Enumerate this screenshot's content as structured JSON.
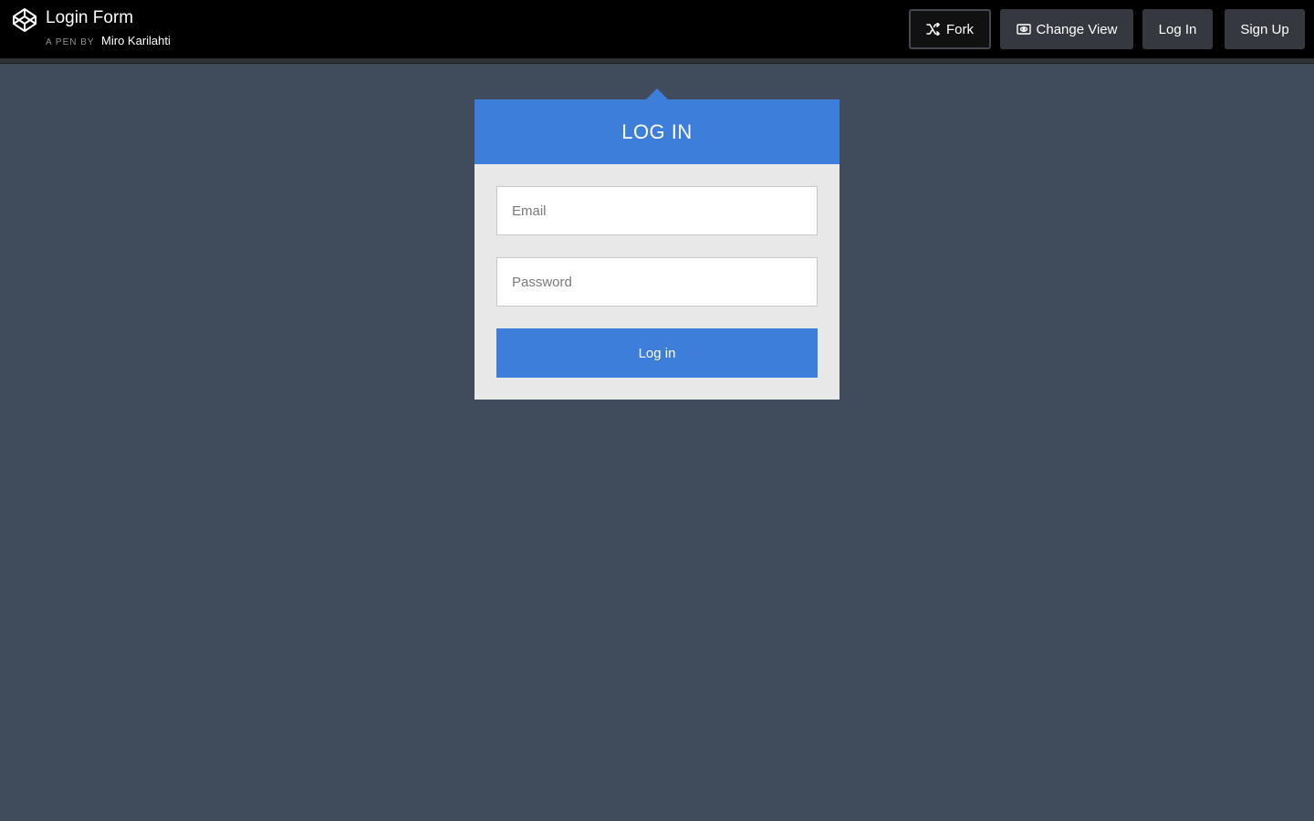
{
  "header": {
    "pen_title": "Login Form",
    "pen_by_label": "A PEN BY",
    "author": "Miro Karilahti",
    "logo_icon": "codepen-logo-icon",
    "buttons": {
      "fork": {
        "label": "Fork",
        "icon": "fork-icon"
      },
      "change_view": {
        "label": "Change View",
        "icon": "eye-icon"
      },
      "login": {
        "label": "Log In"
      },
      "signup": {
        "label": "Sign Up"
      }
    }
  },
  "login_card": {
    "title": "LOG IN",
    "email": {
      "value": "",
      "placeholder": "Email"
    },
    "password": {
      "value": "",
      "placeholder": "Password"
    },
    "submit_label": "Log in"
  },
  "colors": {
    "page_background": "#404c5c",
    "header_background": "#000000",
    "accent": "#3d7edb",
    "card_background": "#e8e8e8",
    "header_button": "#35383f"
  }
}
